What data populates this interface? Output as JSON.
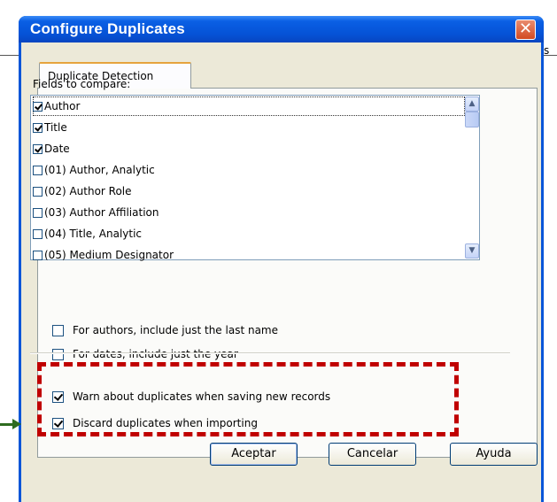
{
  "window": {
    "title": "Configure Duplicates"
  },
  "background": {
    "fragment_text": "s"
  },
  "tabs": [
    {
      "label": "Duplicate Detection"
    }
  ],
  "fields": {
    "label": "Fields to compare:",
    "items": [
      {
        "label": "Author",
        "checked": true
      },
      {
        "label": "Title",
        "checked": true
      },
      {
        "label": "Date",
        "checked": true
      },
      {
        "label": "(01) Author, Analytic",
        "checked": false
      },
      {
        "label": "(02) Author Role",
        "checked": false
      },
      {
        "label": "(03) Author Affiliation",
        "checked": false
      },
      {
        "label": "(04) Title, Analytic",
        "checked": false
      },
      {
        "label": "(05) Medium Designator",
        "checked": false
      }
    ]
  },
  "options": [
    {
      "label": "For authors, include just the last name",
      "checked": false
    },
    {
      "label": "For dates, include just the year",
      "checked": false
    },
    {
      "label": "Warn about duplicates when saving new records",
      "checked": true
    },
    {
      "label": "Discard duplicates when importing",
      "checked": true
    }
  ],
  "buttons": {
    "ok": "Aceptar",
    "cancel": "Cancelar",
    "help": "Ayuda"
  },
  "colors": {
    "highlight_box": "#c00000",
    "arrow": "#2e6b1f",
    "titlebar": "#0552d6"
  }
}
